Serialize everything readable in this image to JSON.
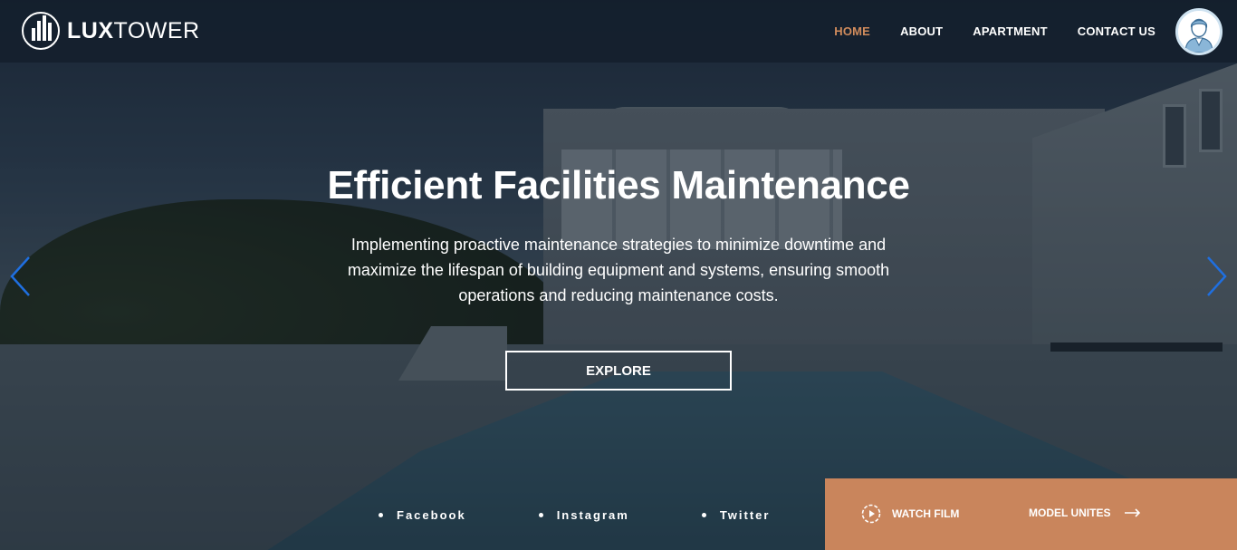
{
  "brand": {
    "name_bold": "LUX",
    "name_light": "TOWER"
  },
  "nav": {
    "items": [
      {
        "label": "HOME",
        "active": true
      },
      {
        "label": "ABOUT",
        "active": false
      },
      {
        "label": "APARTMENT",
        "active": false
      },
      {
        "label": "CONTACT US",
        "active": false
      }
    ],
    "accent_color": "#d08b5c"
  },
  "hero": {
    "title": "Efficient Facilities Maintenance",
    "subtitle": "Implementing proactive maintenance strategies to minimize downtime and maximize the lifespan of building equipment and systems, ensuring smooth operations and reducing maintenance costs.",
    "cta_label": "EXPLORE"
  },
  "socials": [
    {
      "label": "Facebook"
    },
    {
      "label": "Instagram"
    },
    {
      "label": "Twitter"
    }
  ],
  "cta_panel": {
    "watch_label": "WATCH FILM",
    "model_label": "MODEL UNITES",
    "background_color": "#c9855c"
  },
  "icons": {
    "logo": "building-logo-icon",
    "avatar": "user-avatar-icon",
    "prev": "chevron-left-icon",
    "next": "chevron-right-icon",
    "play": "play-circle-icon",
    "arrow": "arrow-right-icon"
  }
}
